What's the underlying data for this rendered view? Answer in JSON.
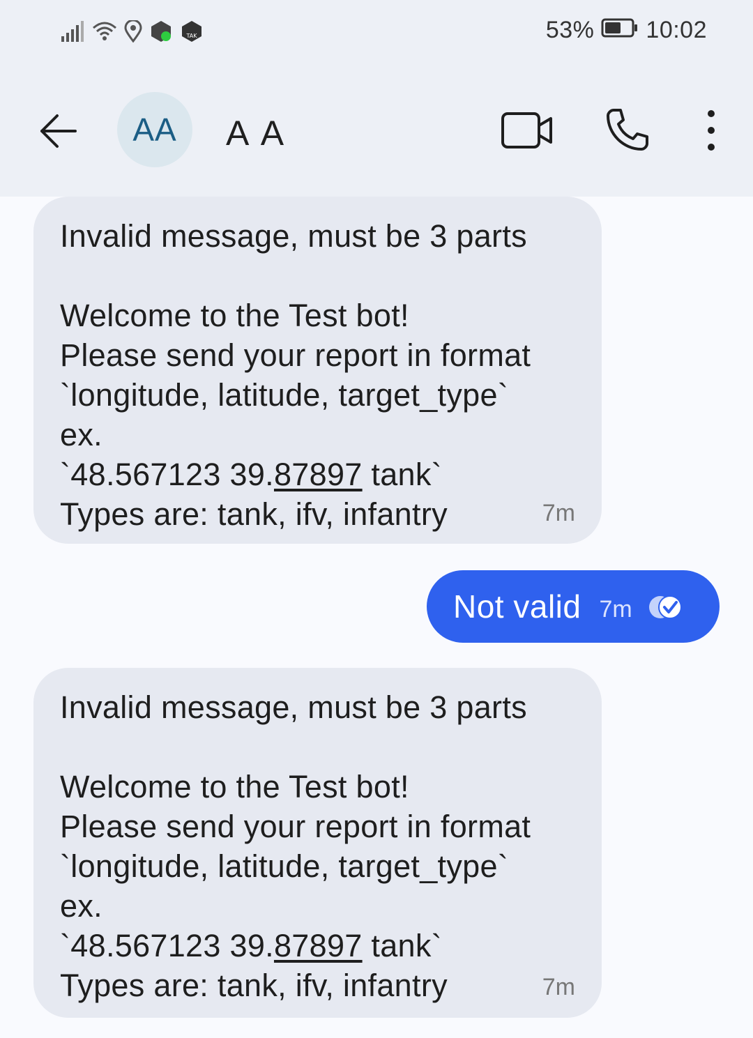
{
  "status_bar": {
    "battery": "53%",
    "time": "10:02",
    "icons": [
      "signal-icon",
      "wifi-icon",
      "location-icon",
      "app-notification-icon",
      "tak-icon"
    ],
    "tak_label": "TAK"
  },
  "header": {
    "avatar_initials": "AA",
    "contact_name": "A A"
  },
  "messages": [
    {
      "direction": "incoming",
      "line1": "Invalid message, must be 3 parts",
      "line2": "",
      "line3": "Welcome to the Test bot!",
      "line4": "Please send your report in format",
      "line5": "`longitude, latitude, target_type`",
      "line6": "ex.",
      "line7_a": "`48.567123 39.",
      "line7_link": "87897",
      "line7_b": " tank`",
      "line8": "Types are: tank, ifv, infantry",
      "time": "7m"
    },
    {
      "direction": "outgoing",
      "text": "Not valid",
      "time": "7m",
      "status_icon": "read-check-icon"
    },
    {
      "direction": "incoming",
      "line1": "Invalid message, must be 3 parts",
      "line2": "",
      "line3": "Welcome to the Test bot!",
      "line4": "Please send your report in format",
      "line5": "`longitude, latitude, target_type`",
      "line6": "ex.",
      "line7_a": "`48.567123 39.",
      "line7_link": "87897",
      "line7_b": " tank`",
      "line8": "Types are: tank, ifv, infantry",
      "time": "7m"
    }
  ],
  "colors": {
    "outgoing_bubble": "#2f61ee",
    "incoming_bubble": "#e6e9f1",
    "header_bg": "#edf0f6",
    "avatar_bg": "#dbe7ee",
    "avatar_text": "#1b5e85"
  }
}
